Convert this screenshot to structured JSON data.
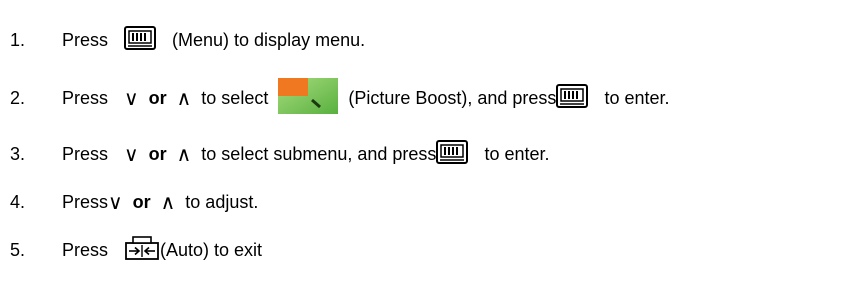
{
  "steps": [
    {
      "number": "1.",
      "press": "Press",
      "icon": "menu-button-icon",
      "after": "(Menu) to display menu."
    },
    {
      "number": "2.",
      "press": "Press",
      "down": "∨",
      "or": "or",
      "up": "∧",
      "select": "to select",
      "icon": "picture-boost-icon",
      "after": "(Picture Boost), and press",
      "icon2": "menu-button-icon",
      "end": "to enter."
    },
    {
      "number": "3.",
      "press": "Press",
      "down": "∨",
      "or": "or",
      "up": "∧",
      "select": "to select submenu, and press",
      "icon": "menu-button-icon",
      "end": "to enter."
    },
    {
      "number": "4.",
      "press": "Press",
      "down": "∨",
      "or": "or",
      "up": "∧",
      "after": "to adjust."
    },
    {
      "number": "5.",
      "press": "Press",
      "icon": "auto-button-icon",
      "after": "(Auto) to exit"
    }
  ],
  "colors": {
    "text": "#000000",
    "picture_boost_orange": "#f07820",
    "picture_boost_green": "#7cc85a"
  }
}
